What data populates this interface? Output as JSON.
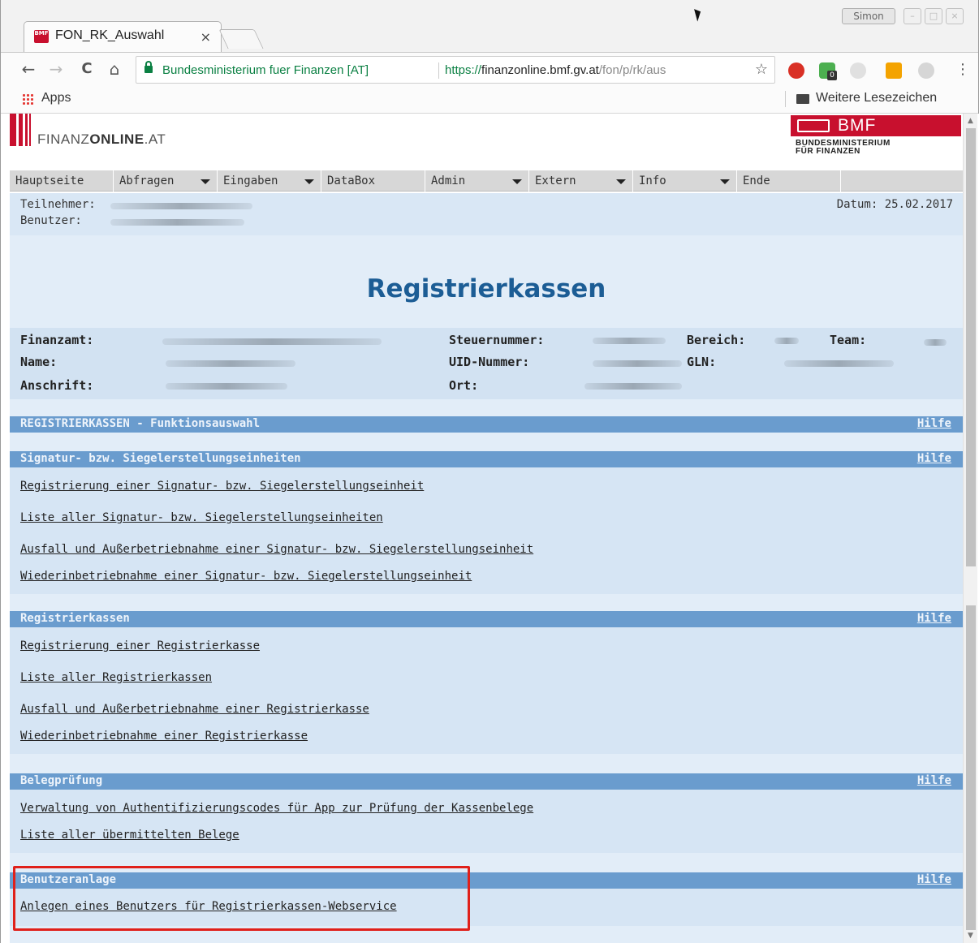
{
  "browser": {
    "tab_title": "FON_RK_Auswahl",
    "tab_close": "×",
    "favicon_text": "BMF",
    "user_chip": "Simon",
    "site_name": "Bundesministerium fuer Finanzen [AT]",
    "url_scheme": "https://",
    "url_host": "finanzonline.bmf.gv.at",
    "url_path": "/fon/p/rk/aus",
    "bookmarks": {
      "apps": "Apps",
      "other": "Weitere Lesezeichen"
    },
    "nav": {
      "back": "←",
      "forward": "→",
      "reload": "C",
      "home": "⌂",
      "star": "☆",
      "menu": "⋮"
    },
    "window_buttons": [
      "–",
      "□",
      "×"
    ],
    "extension_badge": "0"
  },
  "header": {
    "logo_prefix": "FINANZ",
    "logo_bold": "ONLINE",
    "logo_suffix": ".AT",
    "bmf": "BMF",
    "bmf_sub_1": "BUNDESMINISTERIUM",
    "bmf_sub_2": "FÜR FINANZEN"
  },
  "menu": [
    {
      "label": "Hauptseite",
      "dropdown": false
    },
    {
      "label": "Abfragen",
      "dropdown": true
    },
    {
      "label": "Eingaben",
      "dropdown": true
    },
    {
      "label": "DataBox",
      "dropdown": false
    },
    {
      "label": "Admin",
      "dropdown": true
    },
    {
      "label": "Extern",
      "dropdown": true
    },
    {
      "label": "Info",
      "dropdown": true
    },
    {
      "label": "Ende",
      "dropdown": false
    }
  ],
  "user": {
    "teilnehmer_label": "Teilnehmer:",
    "benutzer_label": "Benutzer:",
    "datum": "Datum: 25.02.2017"
  },
  "title": "Registrierkassen",
  "info": {
    "finanzamt": "Finanzamt:",
    "name": "Name:",
    "anschrift": "Anschrift:",
    "steuernummer": "Steuernummer:",
    "uid": "UID-Nummer:",
    "ort": "Ort:",
    "bereich": "Bereich:",
    "gln": "GLN:",
    "team": "Team:"
  },
  "sections": {
    "funktion": {
      "title": "REGISTRIERKASSEN - Funktionsauswahl",
      "help": "Hilfe"
    },
    "signatur": {
      "title": "Signatur- bzw. Siegelerstellungseinheiten",
      "help": "Hilfe",
      "links": [
        "Registrierung einer Signatur- bzw. Siegelerstellungseinheit",
        "Liste aller Signatur- bzw. Siegelerstellungseinheiten",
        "Ausfall und Außerbetriebnahme einer Signatur- bzw. Siegelerstellungseinheit",
        "Wiederinbetriebnahme einer Signatur- bzw. Siegelerstellungseinheit"
      ]
    },
    "kassen": {
      "title": "Registrierkassen",
      "help": "Hilfe",
      "links": [
        "Registrierung einer Registrierkasse",
        "Liste aller Registrierkassen",
        "Ausfall und Außerbetriebnahme einer Registrierkasse",
        "Wiederinbetriebnahme einer Registrierkasse"
      ]
    },
    "beleg": {
      "title": "Belegprüfung",
      "help": "Hilfe",
      "links": [
        "Verwaltung von Authentifizierungscodes für App zur Prüfung der Kassenbelege",
        "Liste aller übermittelten Belege"
      ]
    },
    "benutzer": {
      "title": "Benutzeranlage",
      "help": "Hilfe",
      "links": [
        "Anlegen eines Benutzers für Registrierkassen-Webservice"
      ]
    }
  },
  "colors": {
    "brand_red": "#c8102e",
    "section_header": "#6a9cce",
    "title_blue": "#1c5d95",
    "highlight": "#e0201a"
  }
}
